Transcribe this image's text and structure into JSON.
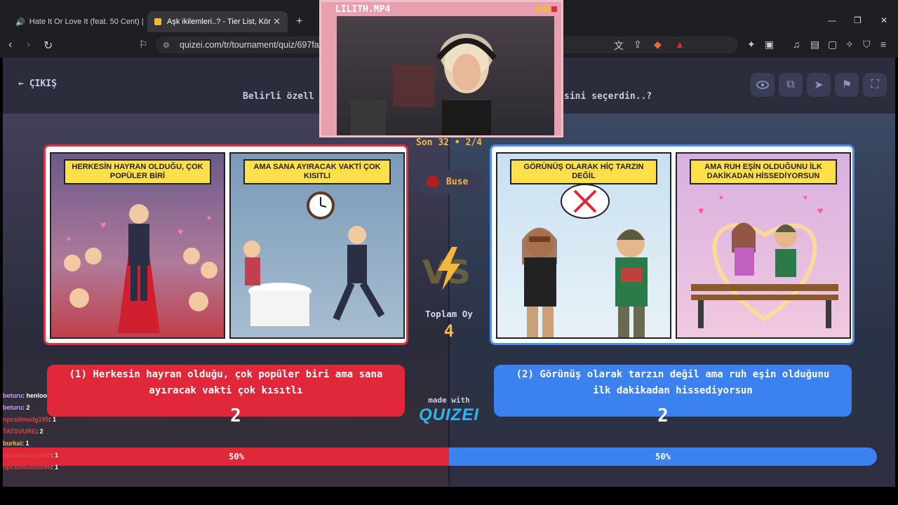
{
  "browser": {
    "tabs": [
      {
        "title": "Hate It Or Love It (feat. 50 Cent) |",
        "active": false
      },
      {
        "title": "Aşk ikilemleri..? - Tier List, Kör Sı",
        "active": true
      }
    ],
    "new_tab": "+",
    "url": "quizei.com/tr/tournament/quiz/697fa4",
    "window_controls": {
      "minimize": "—",
      "maximize": "❐",
      "close": "✕"
    }
  },
  "webcam": {
    "title": "LILITH.MP4"
  },
  "quiz": {
    "exit_label": "ÇIKIŞ",
    "question_left": "Belirli özell",
    "question_right": "sini seçerdin..?",
    "round": "Son 32 • 2/4",
    "user": "Buse",
    "total_label": "Toplam Oy",
    "total_votes": "4",
    "made_with": "made with",
    "logo": "QUIZEI",
    "left": {
      "caption1": "HERKESİN HAYRAN OLDUĞU, ÇOK POPÜLER BİRİ",
      "caption2": "AMA SANA AYIRACAK VAKTİ ÇOK KISITLI",
      "option_text": "(1) Herkesin hayran olduğu, çok popüler biri ama sana ayıracak vakti çok kısıtlı",
      "votes": "2",
      "percent_label": "50%",
      "percent": 50
    },
    "right": {
      "caption1": "GÖRÜNÜŞ OLARAK HİÇ TARZIN DEĞİL",
      "caption2": "AMA RUH EŞİN OLDUĞUNU İLK DAKİKADAN HİSSEDİYORSUN",
      "option_text": "(2) Görünüş olarak tarzın değil ama ruh eşin olduğunu ilk dakikadan hissediyorsun",
      "votes": "2",
      "percent_label": "50%",
      "percent": 50
    }
  },
  "chat": [
    {
      "user": "beturu",
      "msg": ": henloo",
      "color": "#c9a0ff"
    },
    {
      "user": "beturu",
      "msg": ": 2",
      "color": "#c9a0ff"
    },
    {
      "user": "npcsilmudg195",
      "msg": ": 1",
      "color": "#e04040"
    },
    {
      "user": "TATSVURE",
      "msg": ": 2",
      "color": "#e04040"
    },
    {
      "user": "burkai",
      "msg": ": 1",
      "color": "#f4b63c"
    },
    {
      "user": "npcsilmukreb95",
      "msg": ": 1",
      "color": "#e04040"
    },
    {
      "user": "npcsilmukreb96",
      "msg": ": 1",
      "color": "#e04040"
    }
  ],
  "colors": {
    "left_accent": "#e0283a",
    "right_accent": "#3b82f0",
    "gold": "#f4b63c"
  }
}
